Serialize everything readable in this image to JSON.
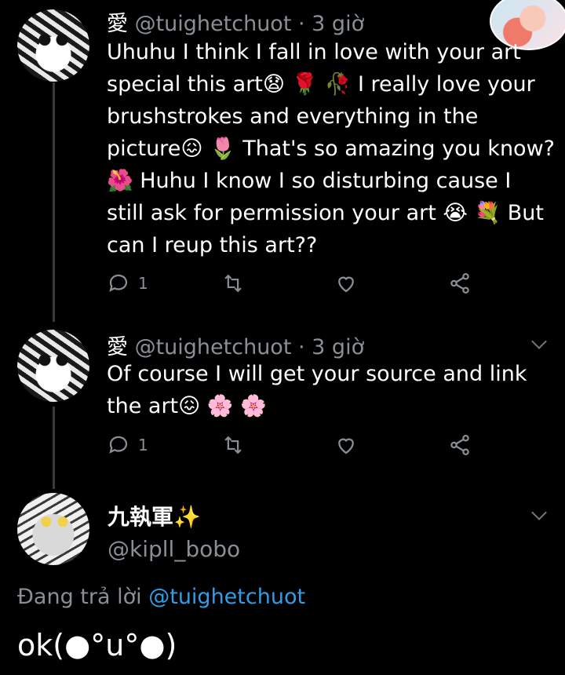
{
  "tweets": [
    {
      "display_name": "愛",
      "meta": "@tuighetchuot · 3 giờ",
      "lines": [
        {
          "text": "Uhuhu I think I fall in love with your art"
        },
        {
          "text": "special this art",
          "after": "😧 🌹 🥀 I really love your"
        },
        {
          "text": "brushstrokes and everything in the"
        },
        {
          "text": "picture",
          "after": "😖 🌷  That's so amazing you know?"
        },
        {
          "text": "🌺  Huhu I know I so disturbing cause I"
        },
        {
          "text": "still ask for permission your art ",
          "after": "😭 💐  But"
        },
        {
          "text": "can I reup this art??"
        }
      ],
      "reply_count": "1"
    },
    {
      "display_name": "愛",
      "meta": "@tuighetchuot · 3 giờ",
      "lines": [
        {
          "text": "Of course I will get your source and link"
        },
        {
          "text": "the art",
          "after": "😖 🌸 🌸"
        }
      ],
      "reply_count": "1"
    }
  ],
  "composer": {
    "display_name": "九執軍✨",
    "handle": "@kipll_bobo",
    "replying_prefix": "Đang trả lời",
    "replying_mention": "@tuighetchuot",
    "reply_text": "ok(●°u°●)"
  },
  "icons": {
    "reply": "reply-icon",
    "retweet": "retweet-icon",
    "like": "heart-icon",
    "share": "share-icon"
  },
  "colors": {
    "background": "#000000",
    "muted": "#8a8f95",
    "link": "#2f9de8"
  }
}
